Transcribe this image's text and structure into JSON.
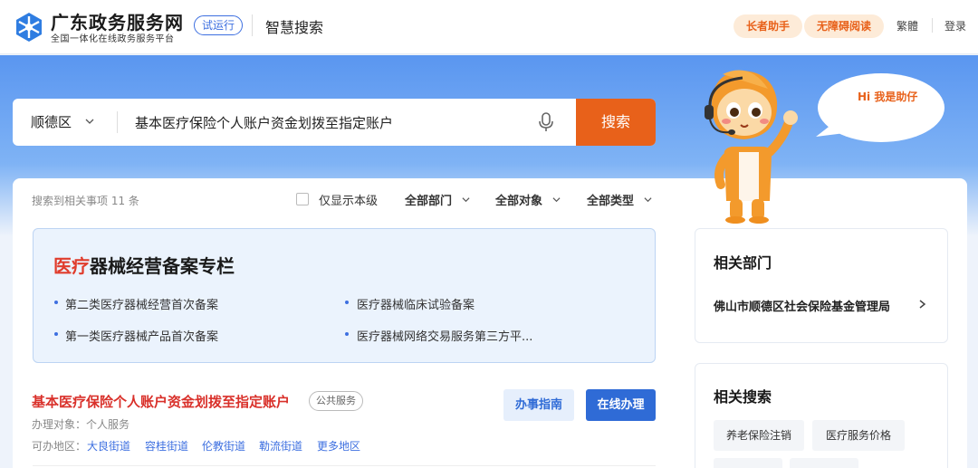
{
  "header": {
    "site_name": "广东政务服务网",
    "site_subtitle": "全国一体化在线政务服务平台",
    "trial_badge": "试运行",
    "app_title": "智慧搜索",
    "elder_assist": "长者助手",
    "accessible_read": "无障碍阅读",
    "traditional": "繁體",
    "login": "登录"
  },
  "search": {
    "region": "顺德区",
    "query": "基本医疗保险个人账户资金划拨至指定账户",
    "button": "搜索"
  },
  "assistant": {
    "greeting": "Hi 我是助仔"
  },
  "filters": {
    "result_count": "搜索到相关事项 11 条",
    "only_this_level": "仅显示本级",
    "dept": "全部部门",
    "target": "全部对象",
    "type": "全部类型"
  },
  "special": {
    "title_highlight": "医疗",
    "title_rest": "器械经营备案专栏",
    "items": [
      "第二类医疗器械经营首次备案",
      "医疗器械临床试验备案",
      "第一类医疗器械产品首次备案",
      "医疗器械网络交易服务第三方平..."
    ]
  },
  "result": {
    "title": "基本医疗保险个人账户资金划拨至指定账户",
    "tag": "公共服务",
    "target": "办理对象：个人服务",
    "area_label": "可办地区：",
    "areas": [
      "大良街道",
      "容桂街道",
      "伦教街道",
      "勒流街道",
      "更多地区"
    ],
    "guide_button": "办事指南",
    "online_button": "在线办理"
  },
  "sidebar": {
    "dept_title": "相关部门",
    "dept_name": "佛山市顺德区社会保险基金管理局",
    "search_title": "相关搜索",
    "chips": [
      "养老保险注销",
      "医疗服务价格"
    ]
  },
  "colors": {
    "accent_orange": "#e8611a",
    "primary_blue": "#2f6bd6",
    "highlight_red": "#d9302a"
  }
}
